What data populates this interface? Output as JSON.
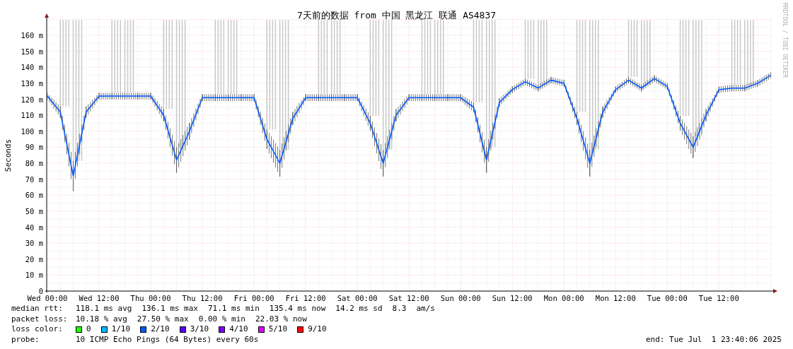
{
  "chart": {
    "chart_data": {
      "type": "line",
      "title": "7天前的数据 from 中国 黑龙江 联通 AS4837",
      "ylabel": "Seconds",
      "categories": [
        "Wed 00:00",
        null,
        null,
        null,
        "Wed 12:00",
        null,
        null,
        null,
        "Thu 00:00",
        null,
        null,
        null,
        "Thu 12:00",
        null,
        null,
        null,
        "Fri 00:00",
        null,
        null,
        null,
        "Fri 12:00",
        null,
        null,
        null,
        "Sat 00:00",
        null,
        null,
        null,
        "Sat 12:00",
        null,
        null,
        null,
        "Sun 00:00",
        null,
        null,
        null,
        "Sun 12:00",
        null,
        null,
        null,
        "Mon 00:00",
        null,
        null,
        null,
        "Mon 12:00",
        null,
        null,
        null,
        "Tue 00:00",
        null,
        null,
        null,
        "Tue 12:00",
        null,
        null,
        null,
        null
      ],
      "series": [
        {
          "name": "median rtt:",
          "color": "#0059ff",
          "values": [
            122,
            112,
            72,
            112,
            122,
            122,
            122,
            122,
            122,
            110,
            82,
            100,
            121,
            121,
            121,
            121,
            121,
            95,
            80,
            108,
            121,
            121,
            121,
            121,
            121,
            105,
            80,
            110,
            121,
            121,
            121,
            121,
            121,
            115,
            82,
            118,
            126,
            131,
            127,
            132,
            130,
            108,
            80,
            112,
            126,
            132,
            127,
            133,
            128,
            105,
            90,
            110,
            126,
            127,
            127,
            130,
            135
          ]
        }
      ],
      "ylim": [
        0,
        170
      ],
      "grid": true,
      "yticks": [
        {
          "value": 0,
          "label": "0"
        },
        {
          "value": 10,
          "label": "10 m"
        },
        {
          "value": 20,
          "label": "20 m"
        },
        {
          "value": 30,
          "label": "30 m"
        },
        {
          "value": 40,
          "label": "40 m"
        },
        {
          "value": 50,
          "label": "50 m"
        },
        {
          "value": 60,
          "label": "60 m"
        },
        {
          "value": 70,
          "label": "70 m"
        },
        {
          "value": 80,
          "label": "80 m"
        },
        {
          "value": 90,
          "label": "90 m"
        },
        {
          "value": 100,
          "label": "100 m"
        },
        {
          "value": 110,
          "label": "110 m"
        },
        {
          "value": 120,
          "label": "120 m"
        },
        {
          "value": 130,
          "label": "130 m"
        },
        {
          "value": 140,
          "label": "140 m"
        },
        {
          "value": 150,
          "label": "150 m"
        },
        {
          "value": 160,
          "label": "160 m"
        }
      ]
    }
  },
  "credit": "RRDTOOL / TOBI OETIKER",
  "legend": [
    {
      "kind": "series_stats",
      "items": [
        "118.1 ms avg",
        "136.1 ms max",
        "71.1 ms min",
        "135.4 ms now",
        "14.2 ms sd",
        "8.3",
        "am/s"
      ]
    },
    {
      "kind": "stats",
      "label": "packet loss:",
      "items": [
        "10.18 % avg",
        "27.50 % max",
        "0.00 % min",
        "22.03 % now"
      ]
    },
    {
      "kind": "colors",
      "label": "loss color:",
      "items": [
        {
          "text": "0",
          "color": "#26ff00"
        },
        {
          "text": "1/10",
          "color": "#00b8ff"
        },
        {
          "text": "2/10",
          "color": "#0059ff"
        },
        {
          "text": "3/10",
          "color": "#5e00ff"
        },
        {
          "text": "4/10",
          "color": "#7e00ff"
        },
        {
          "text": "5/10",
          "color": "#dd00ff"
        },
        {
          "text": "9/10",
          "color": "#ff0000"
        }
      ]
    },
    {
      "kind": "stats",
      "label": "probe:",
      "items": [
        "10 ICMP Echo Pings (64 Bytes) every 60s"
      ]
    }
  ],
  "end": "end: Tue Jul  1 23:40:06 2025"
}
